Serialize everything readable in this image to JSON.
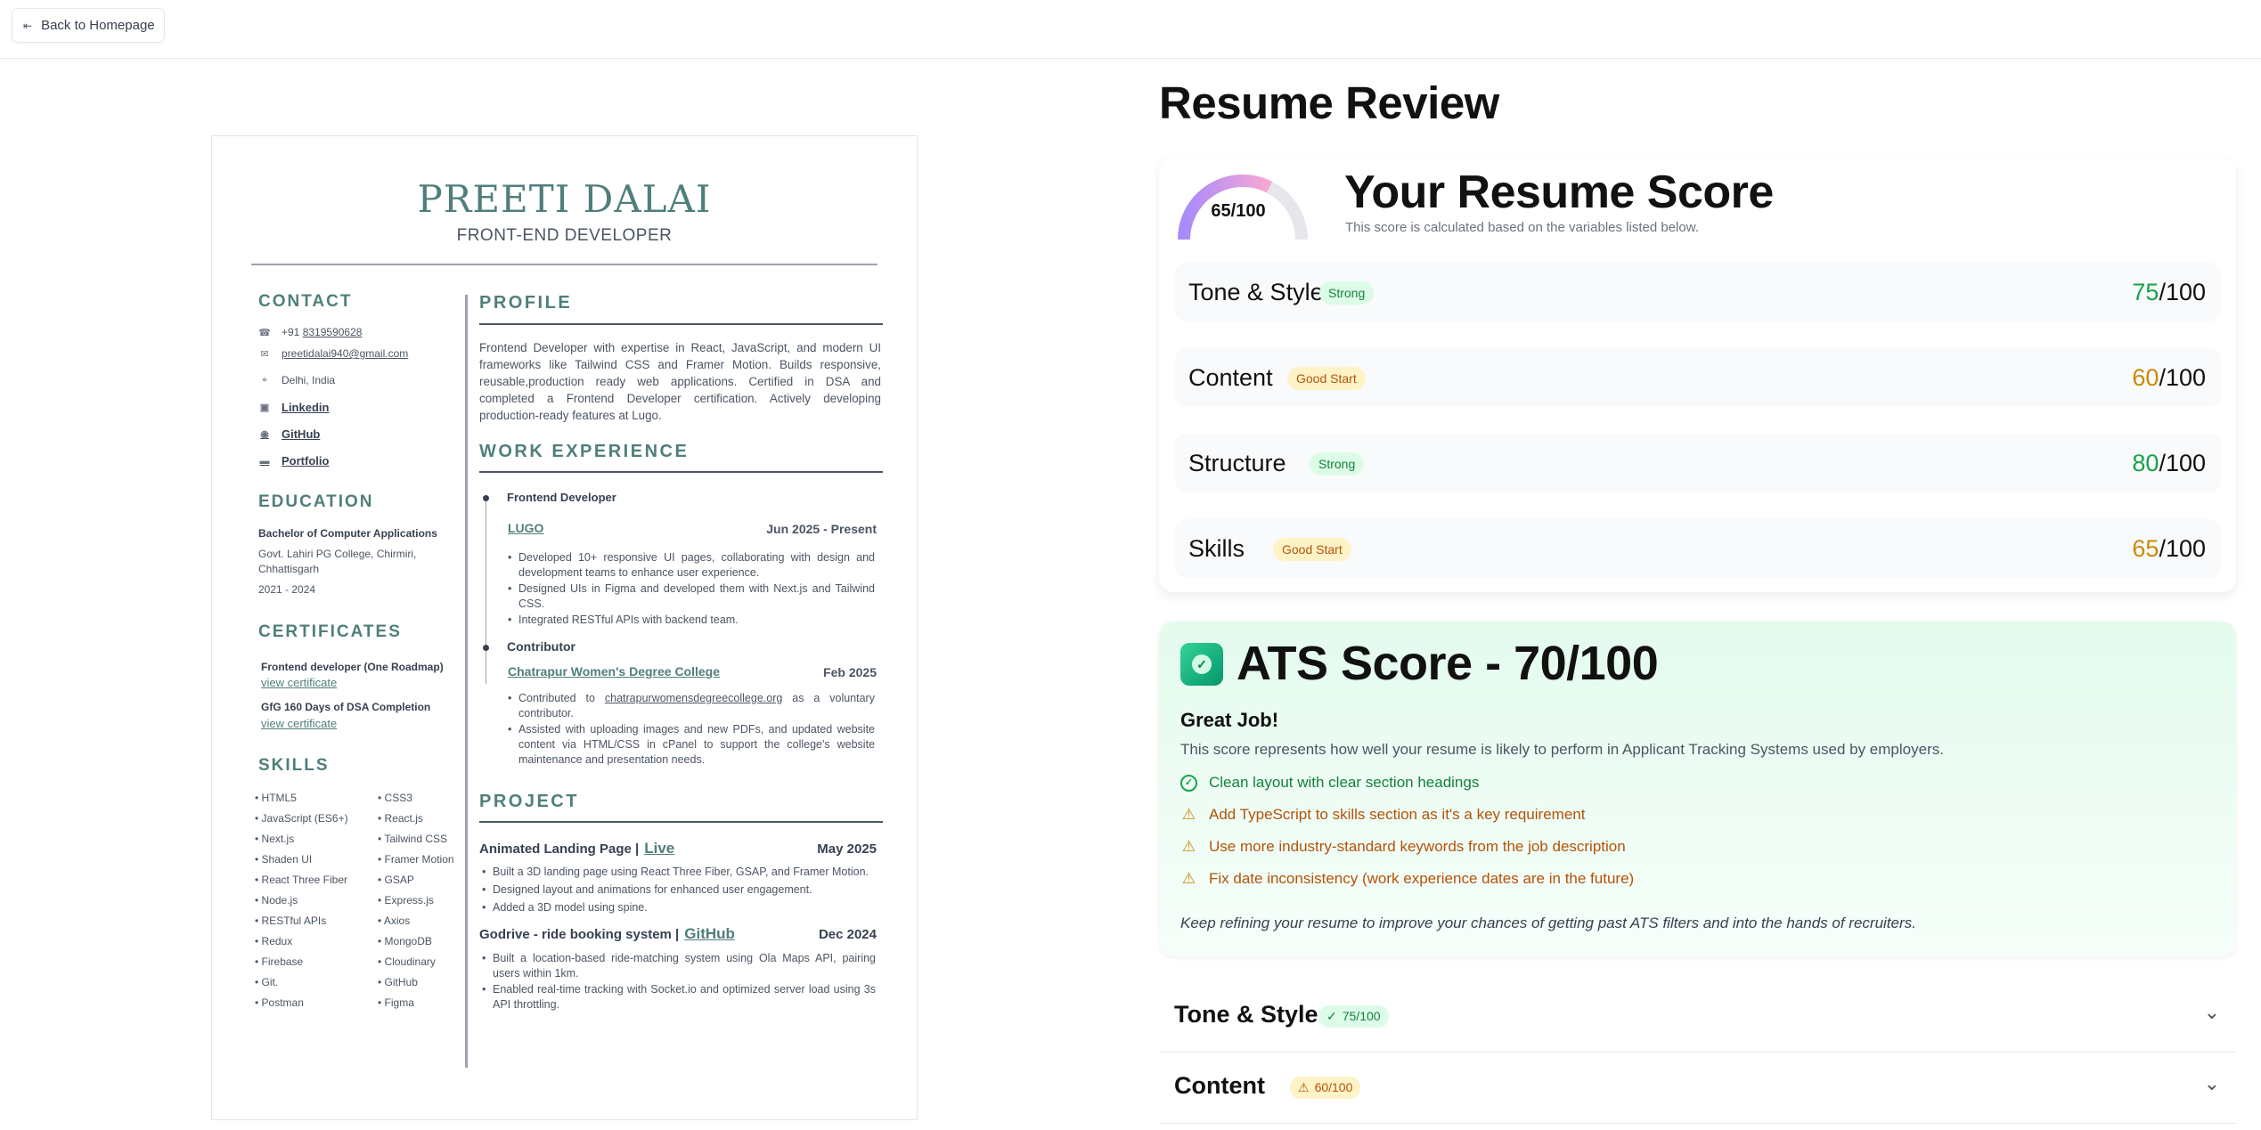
{
  "nav": {
    "back_label": "Back to Homepage"
  },
  "resume": {
    "name": "PREETI DALAI",
    "role": "FRONT-END DEVELOPER",
    "contact_heading": "CONTACT",
    "contact": {
      "phone_prefix": "+91",
      "phone": "8319590628",
      "email": "preetidalai940@gmail.com",
      "location": "Delhi, India",
      "linkedin": "Linkedin",
      "github": "GitHub",
      "portfolio": "Portfolio"
    },
    "education_heading": "EDUCATION",
    "education": {
      "degree": "Bachelor of Computer Applications",
      "college_line1": "Govt. Lahiri PG College, Chirmiri,",
      "college_line2": "Chhattisgarh",
      "years": "2021 - 2024"
    },
    "certificates_heading": "CERTIFICATES",
    "certificates": [
      {
        "title": "Frontend developer (One Roadmap)",
        "link": "view certificate"
      },
      {
        "title": "GfG 160 Days of DSA Completion",
        "link": "view certificate"
      }
    ],
    "skills_heading": "SKILLS",
    "skills_left": [
      "• HTML5",
      "• JavaScript (ES6+)",
      "• Next.js",
      "• Shaden UI",
      "• React Three Fiber",
      "• Node.js",
      "• RESTful APIs",
      "• Redux",
      "• Firebase",
      "• Git.",
      "• Postman"
    ],
    "skills_right": [
      "• CSS3",
      "• React.js",
      "• Tailwind CSS",
      "• Framer Motion",
      "• GSAP",
      "• Express.js",
      "• Axios",
      "• MongoDB",
      "• Cloudinary",
      "• GitHub",
      "• Figma"
    ],
    "profile_heading": "PROFILE",
    "profile_text": "Frontend Developer with expertise in React, JavaScript, and modern UI frameworks like Tailwind CSS and Framer Motion. Builds responsive, reusable,production ready web applications. Certified in DSA and completed a Frontend Developer certification. Actively developing production-ready features at Lugo.",
    "work_heading": "WORK EXPERIENCE",
    "work": [
      {
        "title": "Frontend Developer",
        "company": "LUGO",
        "dates": "Jun 2025 - Present",
        "bullets": [
          "Developed 10+ responsive UI pages, collaborating with design and development teams to enhance user experience.",
          "Designed UIs in Figma and developed them with Next.js and Tailwind CSS.",
          "Integrated RESTful APIs with backend team."
        ]
      },
      {
        "title": "Contributor",
        "company": "Chatrapur Women's Degree College",
        "dates": "Feb  2025",
        "bullet1_prefix": "Contributed to",
        "bullet1_link": "chatrapurwomensdegreecollege.org",
        "bullet1_suffix": "as a voluntary contributor.",
        "bullet2": "Assisted with uploading images and new PDFs, and updated website content via HTML/CSS in cPanel  to support the college's website maintenance and presentation needs."
      }
    ],
    "project_heading": "PROJECT",
    "projects": [
      {
        "title": "Animated Landing Page |",
        "link": "Live",
        "date": "May 2025",
        "bullets": [
          "Built a 3D landing page using React Three Fiber, GSAP, and Framer Motion.",
          "Designed layout and animations for enhanced user engagement.",
          "Added a 3D model using spine."
        ]
      },
      {
        "title": "Godrive - ride booking system |",
        "link": "GitHub",
        "date": "Dec 2024",
        "bullets": [
          "Built a location-based ride-matching system using Ola Maps API, pairing users within 1km.",
          "Enabled real-time tracking with Socket.io and optimized server load using 3s API throttling."
        ]
      }
    ]
  },
  "review": {
    "title": "Resume Review",
    "overall": {
      "score": 65,
      "score_text": "65/100",
      "heading": "Your Resume Score",
      "subtitle": "This score is calculated based on the variables listed below.",
      "gauge_colors": [
        "#a78bfa",
        "#f9a8d4"
      ]
    },
    "categories": [
      {
        "name": "Tone & Style",
        "badge": "Strong",
        "tone": "green",
        "score": "75",
        "max": "/100"
      },
      {
        "name": "Content",
        "badge": "Good Start",
        "tone": "amber",
        "score": "60",
        "max": "/100"
      },
      {
        "name": "Structure",
        "badge": "Strong",
        "tone": "green",
        "score": "80",
        "max": "/100"
      },
      {
        "name": "Skills",
        "badge": "Good Start",
        "tone": "amber",
        "score": "65",
        "max": "/100"
      }
    ],
    "ats": {
      "title": "ATS Score - 70/100",
      "headline": "Great Job!",
      "description": "This score represents how well your resume is likely to perform in Applicant Tracking Systems used by employers.",
      "items": [
        {
          "kind": "ok",
          "text": "Clean layout with clear section headings"
        },
        {
          "kind": "warn",
          "text": "Add TypeScript to skills section as it's a key requirement"
        },
        {
          "kind": "warn",
          "text": "Use more industry-standard keywords from the job description"
        },
        {
          "kind": "warn",
          "text": "Fix date inconsistency (work experience dates are in the future)"
        }
      ],
      "footer": "Keep refining your resume to improve your chances of getting past ATS filters and into the hands of recruiters."
    },
    "accordions": [
      {
        "title": "Tone & Style",
        "badge": "75/100",
        "tone": "green"
      },
      {
        "title": "Content",
        "badge": "60/100",
        "tone": "amber"
      }
    ]
  }
}
